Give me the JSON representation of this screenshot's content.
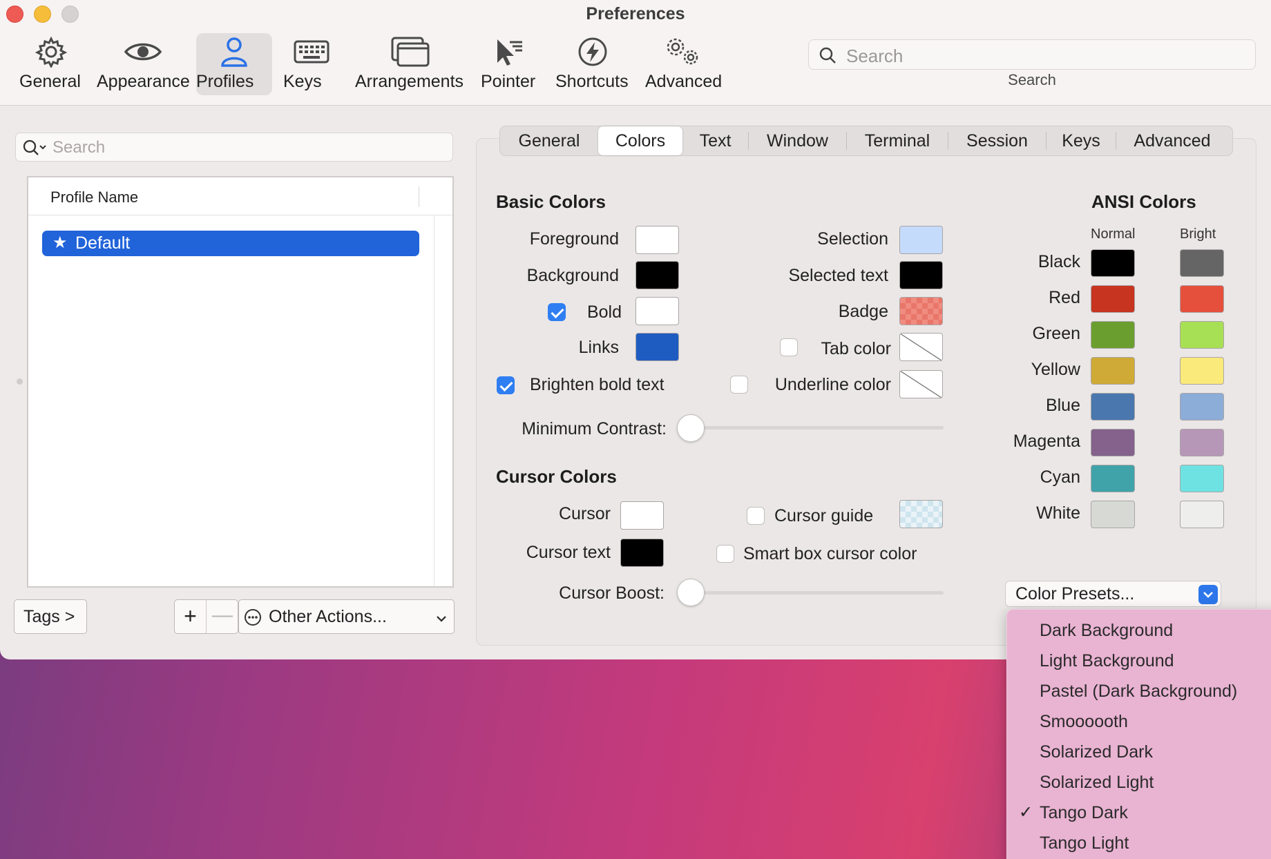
{
  "window": {
    "title": "Preferences"
  },
  "toolbar": {
    "items": [
      {
        "label": "General",
        "icon": "gear-icon"
      },
      {
        "label": "Appearance",
        "icon": "eye-icon"
      },
      {
        "label": "Profiles",
        "icon": "person-icon",
        "active": true
      },
      {
        "label": "Keys",
        "icon": "keyboard-icon"
      },
      {
        "label": "Arrangements",
        "icon": "windows-icon"
      },
      {
        "label": "Pointer",
        "icon": "pointer-icon"
      },
      {
        "label": "Shortcuts",
        "icon": "lightning-icon"
      },
      {
        "label": "Advanced",
        "icon": "gears-icon"
      }
    ],
    "search": {
      "placeholder": "Search",
      "caption": "Search"
    }
  },
  "profiles": {
    "search_placeholder": "Search",
    "column_header": "Profile Name",
    "items": [
      {
        "name": "Default",
        "selected": true,
        "star": "★"
      }
    ],
    "tags_button": "Tags >",
    "add_button": "+",
    "remove_button": "—",
    "other_actions": "Other Actions..."
  },
  "tabs": {
    "items": [
      "General",
      "Colors",
      "Text",
      "Window",
      "Terminal",
      "Session",
      "Keys",
      "Advanced"
    ],
    "selected": "Colors"
  },
  "basic_colors": {
    "title": "Basic Colors",
    "foreground": {
      "label": "Foreground",
      "color": "#ffffff"
    },
    "background": {
      "label": "Background",
      "color": "#000000"
    },
    "bold": {
      "label": "Bold",
      "checked": true,
      "color": "#ffffff"
    },
    "links": {
      "label": "Links",
      "color": "#1f5cc2"
    },
    "selection": {
      "label": "Selection",
      "color": "#c5dbfb"
    },
    "selected_text": {
      "label": "Selected text",
      "color": "#000000"
    },
    "badge": {
      "label": "Badge",
      "color": "#f08c80"
    },
    "tab_color": {
      "label": "Tab color",
      "checked": false
    },
    "brighten_bold": {
      "label": "Brighten bold text",
      "checked": true
    },
    "underline_color": {
      "label": "Underline color",
      "checked": false
    },
    "min_contrast": {
      "label": "Minimum Contrast:",
      "value": 0
    }
  },
  "cursor_colors": {
    "title": "Cursor Colors",
    "cursor": {
      "label": "Cursor",
      "color": "#ffffff"
    },
    "cursor_text": {
      "label": "Cursor text",
      "color": "#000000"
    },
    "cursor_guide": {
      "label": "Cursor guide",
      "checked": false
    },
    "smart_box": {
      "label": "Smart box cursor color",
      "checked": false
    },
    "cursor_boost": {
      "label": "Cursor Boost:",
      "value": 0
    }
  },
  "ansi": {
    "title": "ANSI Colors",
    "normal_header": "Normal",
    "bright_header": "Bright",
    "rows": [
      {
        "name": "Black",
        "normal": "#000000",
        "bright": "#656565"
      },
      {
        "name": "Red",
        "normal": "#c73420",
        "bright": "#e5503d"
      },
      {
        "name": "Green",
        "normal": "#6a9f2f",
        "bright": "#a8e055"
      },
      {
        "name": "Yellow",
        "normal": "#cfaa36",
        "bright": "#fae97b"
      },
      {
        "name": "Blue",
        "normal": "#4a77ad",
        "bright": "#8badd7"
      },
      {
        "name": "Magenta",
        "normal": "#84628c",
        "bright": "#b697b8"
      },
      {
        "name": "Cyan",
        "normal": "#40a3a9",
        "bright": "#6ee2e2"
      },
      {
        "name": "White",
        "normal": "#d7d9d4",
        "bright": "#eeeeec"
      }
    ]
  },
  "color_presets": {
    "label": "Color Presets...",
    "options": [
      {
        "label": "Dark Background",
        "checked": false
      },
      {
        "label": "Light Background",
        "checked": false
      },
      {
        "label": "Pastel (Dark Background)",
        "checked": false
      },
      {
        "label": "Smoooooth",
        "checked": false
      },
      {
        "label": "Solarized Dark",
        "checked": false
      },
      {
        "label": "Solarized Light",
        "checked": false
      },
      {
        "label": "Tango Dark",
        "checked": true,
        "check_mark": "✓"
      },
      {
        "label": "Tango Light",
        "checked": false
      }
    ]
  }
}
